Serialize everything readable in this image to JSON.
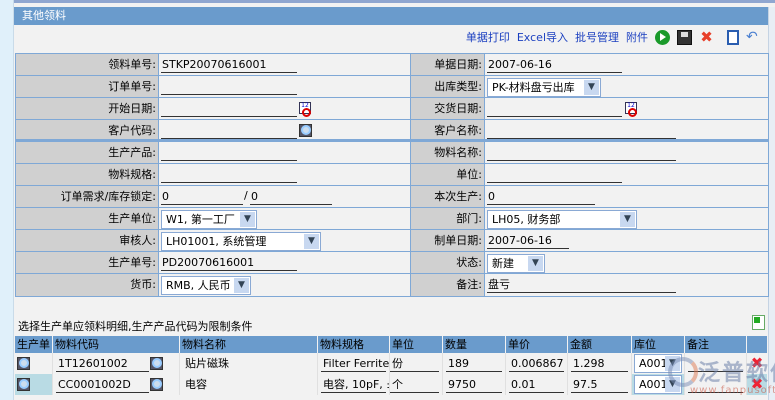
{
  "title": "其他领料",
  "toolbar": {
    "print": "单据打印",
    "excel": "Excel导入",
    "batch": "批号管理",
    "attach": "附件"
  },
  "colors": {
    "title_bar": "#6a9bcc",
    "label_bg": "#d0d0d0",
    "link": "#1a3fc0",
    "row_alt": "#b9dbe4"
  },
  "form": {
    "doc_no_label": "领料单号:",
    "doc_no": "STKP20070616001",
    "doc_date_label": "单据日期:",
    "doc_date": "2007-06-16",
    "order_no_label": "订单单号:",
    "order_no": "",
    "out_type_label": "出库类型:",
    "out_type": "PK-材料盘亏出库",
    "start_date_label": "开始日期:",
    "start_date": "",
    "delivery_date_label": "交货日期:",
    "delivery_date": "",
    "customer_code_label": "客户代码:",
    "customer_code": "",
    "customer_name_label": "客户名称:",
    "customer_name": "",
    "product_label": "生产产品:",
    "product": "",
    "material_name_label": "物料名称:",
    "material_name": "",
    "spec_label": "物料规格:",
    "spec": "",
    "unit_label": "单位:",
    "unit": "",
    "demand_label": "订单需求/库存锁定:",
    "demand": "0",
    "lock_sep": "/",
    "lock": "0",
    "this_prod_label": "本次生产:",
    "this_prod": "0",
    "prod_unit_label": "生产单位:",
    "prod_unit": "W1, 第一工厂",
    "dept_label": "部门:",
    "dept": "LH05, 财务部",
    "reviewer_label": "审核人:",
    "reviewer": "LH01001, 系统管理",
    "made_date_label": "制单日期:",
    "made_date": "2007-06-16",
    "prod_no_label": "生产单号:",
    "prod_no": "PD20070616001",
    "status_label": "状态:",
    "status": "新建",
    "currency_label": "货币:",
    "currency": "RMB, 人民币",
    "remark_label": "备注:",
    "remark": "盘亏"
  },
  "detail": {
    "caption": "选择生产单应领料明细,生产产品代码为限制条件",
    "headers": [
      "生产单",
      "物料代码",
      "物料名称",
      "物料规格",
      "单位",
      "数量",
      "单价",
      "金额",
      "库位",
      "备注"
    ],
    "rows": [
      {
        "code": "1T12601002",
        "name": "贴片磁珠",
        "spec": "Filter Ferrite b",
        "unit": "份",
        "qty": "189",
        "price": "0.006867",
        "amount": "1.298",
        "loc": "A001",
        "remark": ""
      },
      {
        "code": "CC0001002D",
        "name": "电容",
        "spec": "电容, 10pF, ±",
        "unit": "个",
        "qty": "9750",
        "price": "0.01",
        "amount": "97.5",
        "loc": "A001",
        "remark": ""
      }
    ]
  },
  "watermark": {
    "name": "泛普软件",
    "url": "www.fanpusoft.com"
  }
}
